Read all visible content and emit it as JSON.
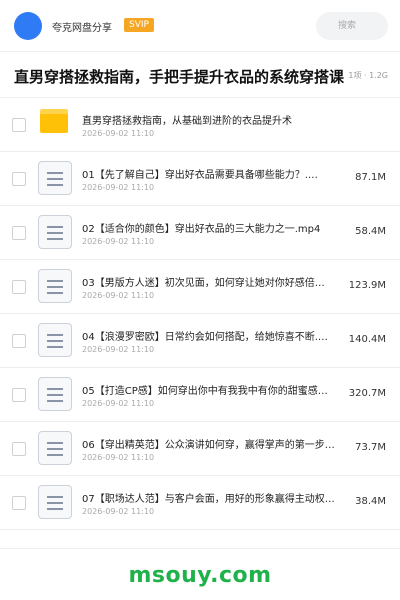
{
  "header": {
    "share_name": "夸克网盘分享",
    "badge": "SVIP",
    "search_placeholder": "搜索"
  },
  "title_bar": {
    "title": "直男穿搭拯救指南，手把手提升衣品的系统穿搭课",
    "meta": "1项 · 1.2G"
  },
  "files": [
    {
      "type": "folder",
      "name": "直男穿搭拯救指南，从基础到进阶的衣品提升术",
      "date": "2026-09-02 11:10",
      "size": ""
    },
    {
      "type": "doc",
      "name": "01【先了解自己】穿出好衣品需要具备哪些能力？.…",
      "date": "2026-09-02 11:10",
      "size": "87.1M"
    },
    {
      "type": "doc",
      "name": "02【适合你的颜色】穿出好衣品的三大能力之一.mp4",
      "date": "2026-09-02 11:10",
      "size": "58.4M"
    },
    {
      "type": "doc",
      "name": "03【男版方人迷】初次见面，如何穿让她对你好感倍…",
      "date": "2026-09-02 11:10",
      "size": "123.9M"
    },
    {
      "type": "doc",
      "name": "04【浪漫罗密欧】日常约会如何搭配，给她惊喜不断.…",
      "date": "2026-09-02 11:10",
      "size": "140.4M"
    },
    {
      "type": "doc",
      "name": "05【打造CP感】如何穿出你中有我我中有你的甜蜜感…",
      "date": "2026-09-02 11:10",
      "size": "320.7M"
    },
    {
      "type": "doc",
      "name": "06【穿出精英范】公众演讲如何穿，赢得掌声的第一步…",
      "date": "2026-09-02 11:10",
      "size": "73.7M"
    },
    {
      "type": "doc",
      "name": "07【职场达人范】与客户会面，用好的形象赢得主动权…",
      "date": "2026-09-02 11:10",
      "size": "38.4M"
    }
  ],
  "footer": {
    "watermark": "msouy.com",
    "watermark_color": "#20b24a"
  },
  "icons": {
    "folder": "folder-icon",
    "file": "video-file-icon"
  }
}
